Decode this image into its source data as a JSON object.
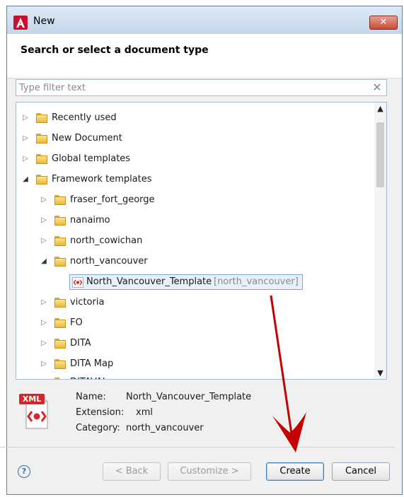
{
  "window": {
    "title": "New",
    "close_label": "✕"
  },
  "header": {
    "title": "Search or select a document type"
  },
  "filter": {
    "placeholder": "Type filter text",
    "value": ""
  },
  "tree": {
    "items": [
      {
        "label": "Recently used",
        "level": 0,
        "expanded": false
      },
      {
        "label": "New Document",
        "level": 0,
        "expanded": false
      },
      {
        "label": "Global templates",
        "level": 0,
        "expanded": false
      },
      {
        "label": "Framework templates",
        "level": 0,
        "expanded": true
      },
      {
        "label": "fraser_fort_george",
        "level": 1,
        "expanded": false
      },
      {
        "label": "nanaimo",
        "level": 1,
        "expanded": false
      },
      {
        "label": "north_cowichan",
        "level": 1,
        "expanded": false
      },
      {
        "label": "north_vancouver",
        "level": 1,
        "expanded": true
      },
      {
        "label": "North_Vancouver_Template",
        "hint": "[north_vancouver]",
        "level": 2,
        "selected": true
      },
      {
        "label": "victoria",
        "level": 1,
        "expanded": false
      },
      {
        "label": "FO",
        "level": 1,
        "expanded": false
      },
      {
        "label": "DITA",
        "level": 1,
        "expanded": false
      },
      {
        "label": "DITA Map",
        "level": 1,
        "expanded": false
      },
      {
        "label": "DITAVAL",
        "level": 1,
        "expanded": false
      }
    ]
  },
  "info": {
    "badge": "XML",
    "name_key": "Name:",
    "name_value": "North_Vancouver_Template",
    "extension_key": "Extension:",
    "extension_value": "xml",
    "category_key": "Category:",
    "category_value": "north_vancouver"
  },
  "buttons": {
    "help": "?",
    "back": "< Back",
    "customize": "Customize >",
    "create": "Create",
    "cancel": "Cancel"
  },
  "colors": {
    "selection_border": "#7fa7dc",
    "annotation_arrow": "#c40000",
    "xml_badge": "#d7262b"
  }
}
